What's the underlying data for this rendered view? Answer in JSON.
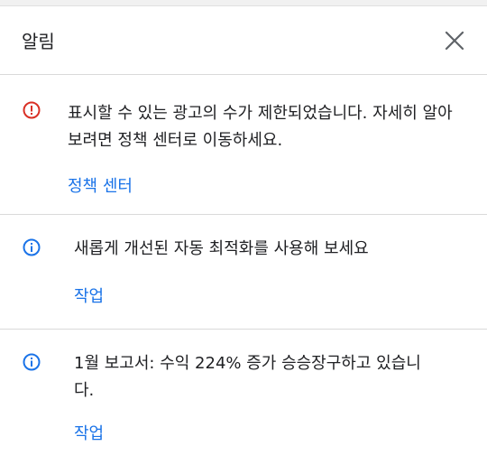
{
  "header": {
    "title": "알림",
    "close_icon": "close-icon"
  },
  "colors": {
    "error": "#d93025",
    "info": "#1a73e8",
    "link": "#1a73e8"
  },
  "notifications": [
    {
      "icon": "error-icon",
      "message": "표시할 수 있는 광고의 수가 제한되었습니다. 자세히 알아보려면 정책 센터로 이동하세요.",
      "action": "정책 센터"
    },
    {
      "icon": "info-icon",
      "message": "새롭게 개선된 자동 최적화를 사용해 보세요",
      "action": "작업"
    },
    {
      "icon": "info-icon",
      "message": "1월 보고서: 수익 224% 증가 승승장구하고 있습니다.",
      "action": "작업"
    }
  ]
}
